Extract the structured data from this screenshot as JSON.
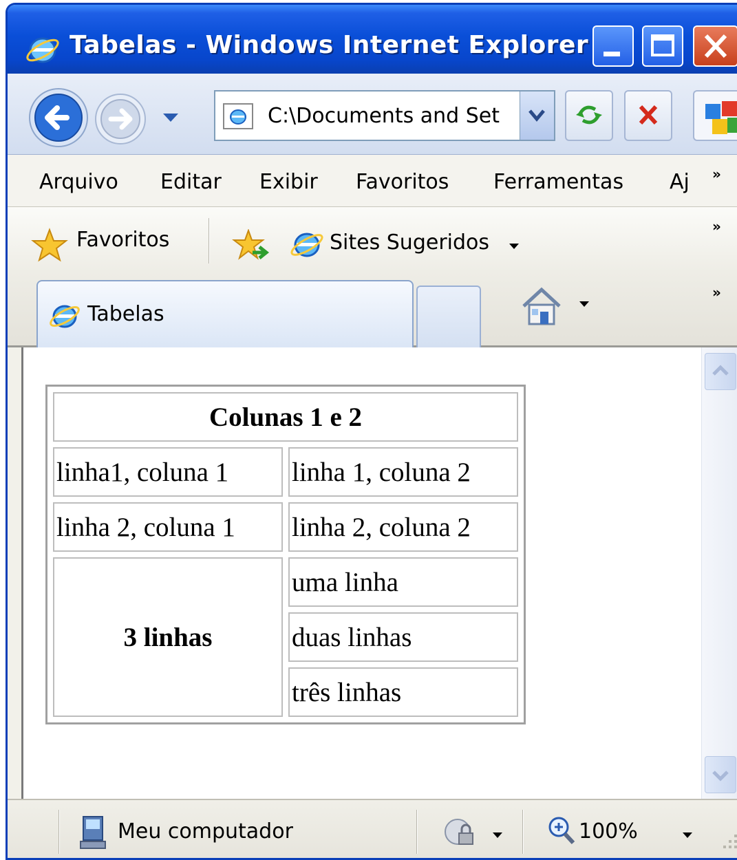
{
  "window": {
    "title": "Tabelas - Windows Internet Explorer"
  },
  "address_bar": {
    "url": "C:\\Documents and Set"
  },
  "menu": {
    "items": [
      "Arquivo",
      "Editar",
      "Exibir",
      "Favoritos",
      "Ferramentas",
      "Aj"
    ],
    "overflow": "»"
  },
  "favorites_bar": {
    "favorites_label": "Favoritos",
    "suggested_sites_label": "Sites Sugeridos",
    "overflow": "»"
  },
  "tabs": {
    "active_label": "Tabelas",
    "overflow": "»"
  },
  "page": {
    "table": {
      "header": "Colunas 1 e 2",
      "rows": [
        [
          "linha1, coluna 1",
          "linha 1, coluna 2"
        ],
        [
          "linha 2, coluna 1",
          "linha 2, coluna 2"
        ]
      ],
      "rowspan_label": "3 linhas",
      "rowspan_cells": [
        "uma linha",
        "duas linhas",
        "três linhas"
      ]
    }
  },
  "status_bar": {
    "zone_label": "Meu computador",
    "zoom": "100%"
  },
  "colors": {
    "titlebar": "#0a4fd8",
    "close_button": "#c8401c",
    "content_bg": "#ffffff"
  },
  "icons": {
    "title": "ie-logo-icon",
    "back": "back-arrow-icon",
    "forward": "forward-arrow-icon",
    "refresh": "refresh-icon",
    "stop": "stop-icon",
    "favorites": "star-icon",
    "add_favorites": "add-favorite-icon",
    "home": "home-icon",
    "computer": "computer-icon",
    "security": "security-icon",
    "zoom": "zoom-icon"
  }
}
